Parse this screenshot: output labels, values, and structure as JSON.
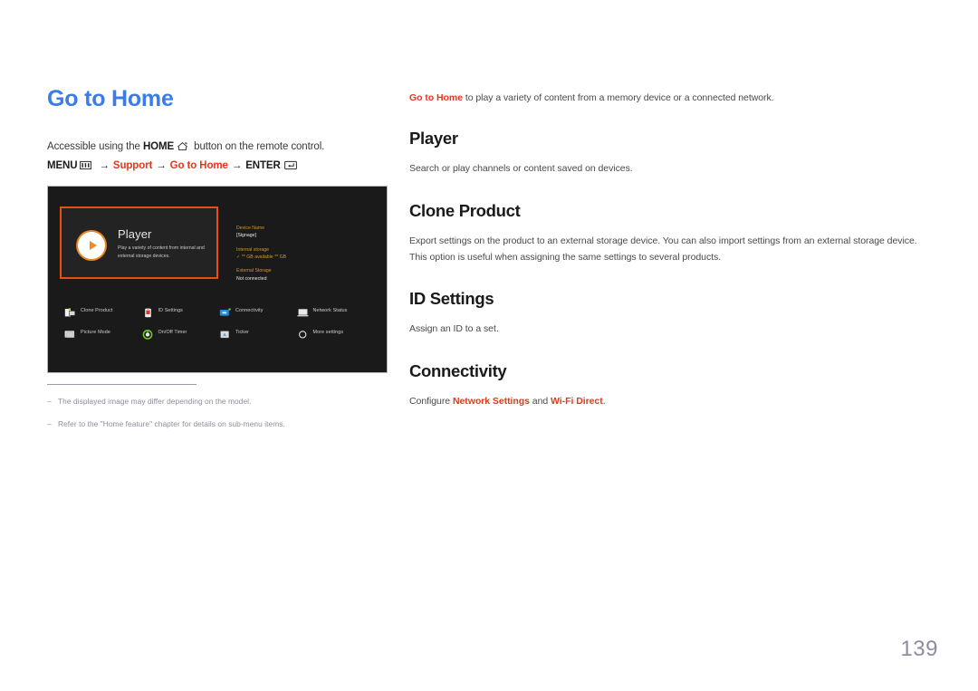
{
  "document": {
    "page_number": "139"
  },
  "left": {
    "title": "Go to Home",
    "accessible": {
      "prefix": "Accessible using the ",
      "home_label": "HOME",
      "home_icon": "home-icon",
      "suffix": " button on the remote control."
    },
    "menu_path": {
      "menu_label": "MENU",
      "menu_icon": "menu-grid-icon",
      "arrow": "→",
      "support": "Support",
      "go_to_home": "Go to Home",
      "enter_label": "ENTER",
      "enter_icon": "enter-return-icon"
    },
    "footnotes": [
      {
        "dash": "–",
        "text": "The displayed image may differ depending on the model."
      },
      {
        "dash": "–",
        "text": "Refer to the \"Home feature\" chapter for details on sub-menu items."
      }
    ]
  },
  "tv_screen": {
    "player_card": {
      "icon": "play-circle-icon",
      "title": "Player",
      "description": "Play a variety of content from internal and external storage devices."
    },
    "device_info": {
      "device_name_label": "Device Name",
      "device_name_value": "[Signage]",
      "internal_storage_label": "Internal storage",
      "internal_storage_value": "✓ ** GB available    ** GB",
      "external_storage_label": "External Storage",
      "external_storage_value": "Not connected"
    },
    "icons": [
      {
        "icon": "clone-product-icon",
        "label": "Clone Product"
      },
      {
        "icon": "id-settings-icon",
        "label": "ID Settings"
      },
      {
        "icon": "connectivity-icon",
        "label": "Connectivity"
      },
      {
        "icon": "network-status-icon",
        "label": "Network Status"
      },
      {
        "icon": "picture-mode-icon",
        "label": "Picture Mode"
      },
      {
        "icon": "on-off-timer-icon",
        "label": "On/Off Timer"
      },
      {
        "icon": "ticker-icon",
        "label": "Ticker"
      },
      {
        "icon": "more-settings-icon",
        "label": "More settings"
      }
    ]
  },
  "right": {
    "intro": {
      "link": "Go to Home",
      "rest": " to play a variety of content from a memory device or a connected network."
    },
    "sections": [
      {
        "heading": "Player",
        "body": "Search or play channels or content saved on devices."
      },
      {
        "heading": "Clone Product",
        "body": "Export settings on the product to an external storage device. You can also import settings from an external storage device. This option is useful when assigning the same settings to several products."
      },
      {
        "heading": "ID Settings",
        "body": "Assign an ID to a set."
      },
      {
        "heading": "Connectivity",
        "body_prefix": "Configure ",
        "body_link1": "Network Settings",
        "body_mid": " and ",
        "body_link2": "Wi-Fi Direct",
        "body_suffix": "."
      }
    ]
  },
  "colors": {
    "title_blue": "#3b7ce8",
    "accent_red": "#e8361c",
    "tv_orange": "#e8500f",
    "info_amber": "#d8942a",
    "muted_gray": "#8d8d9e"
  }
}
